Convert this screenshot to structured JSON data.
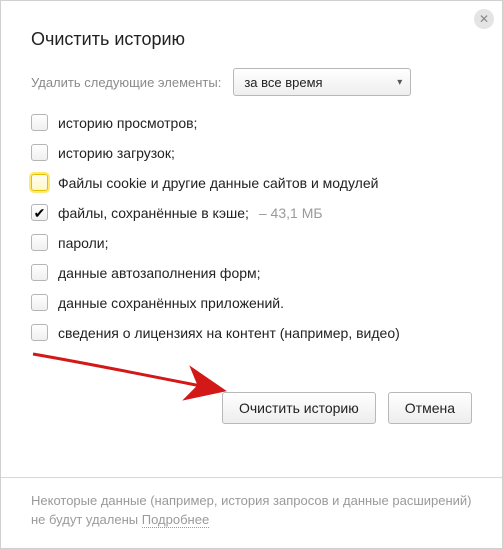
{
  "title": "Очистить историю",
  "close_glyph": "✕",
  "form": {
    "label": "Удалить следующие элементы:",
    "select_value": "за все время",
    "chevron": "▾"
  },
  "checks": [
    {
      "key": "history",
      "label": "историю просмотров;",
      "checked": false,
      "highlight": false
    },
    {
      "key": "downloads",
      "label": "историю загрузок;",
      "checked": false,
      "highlight": false
    },
    {
      "key": "cookies",
      "label": "Файлы cookie и другие данные сайтов и модулей",
      "checked": false,
      "highlight": true
    },
    {
      "key": "cache",
      "label": "файлы, сохранённые в кэше;",
      "sub": " – 43,1 МБ",
      "checked": true,
      "highlight": false
    },
    {
      "key": "passwords",
      "label": "пароли;",
      "checked": false,
      "highlight": false
    },
    {
      "key": "autofill",
      "label": "данные автозаполнения форм;",
      "checked": false,
      "highlight": false
    },
    {
      "key": "apps",
      "label": "данные сохранённых приложений.",
      "checked": false,
      "highlight": false
    },
    {
      "key": "licenses",
      "label": "сведения о лицензиях на контент (например, видео)",
      "checked": false,
      "highlight": false
    }
  ],
  "checkmark_glyph": "✔",
  "buttons": {
    "clear": "Очистить историю",
    "cancel": "Отмена"
  },
  "footer": {
    "text": "Некоторые данные (например, история запросов и данные расширений) не будут удалены ",
    "link": "Подробнее"
  },
  "arrow_color": "#d31818"
}
